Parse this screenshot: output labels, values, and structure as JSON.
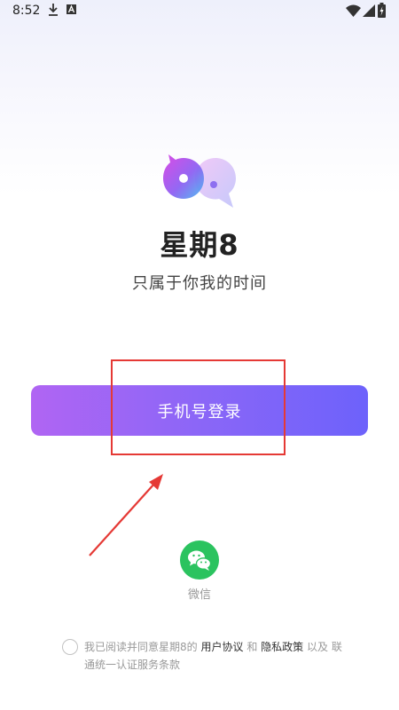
{
  "status_bar": {
    "time": "8:52",
    "icons": [
      "download-icon",
      "a-notification-icon",
      "wifi-icon",
      "signal-icon",
      "battery-charging-icon"
    ]
  },
  "app": {
    "name": "星期8",
    "slogan": "只属于你我的时间",
    "logo_icon": "chat-bubbles-logo-icon"
  },
  "login": {
    "phone_button_label": "手机号登录",
    "wechat_label": "微信",
    "wechat_icon": "wechat-icon"
  },
  "annotation": {
    "highlight_color": "#e53935",
    "arrow_color": "#e53935"
  },
  "agreement": {
    "text1": "我已阅读并同意星期8的",
    "link1": "用户协议",
    "text2": "和",
    "link2": "隐私政策",
    "text3": "以及 联通统一认证服务条款"
  },
  "colors": {
    "button_gradient_start": "#b065f3",
    "button_gradient_end": "#6d62fb",
    "wechat_green": "#2bc35f"
  }
}
